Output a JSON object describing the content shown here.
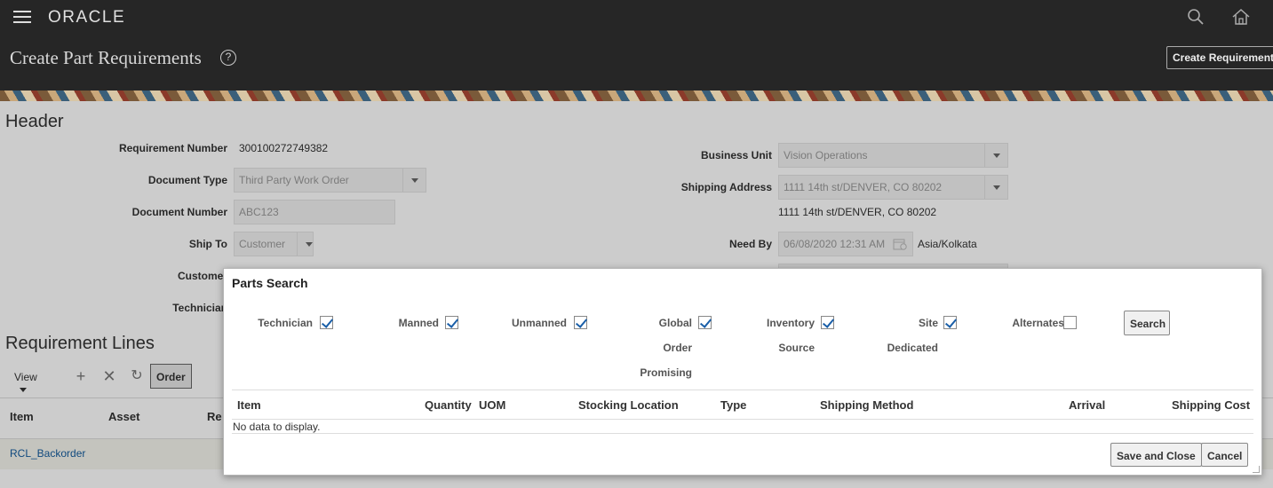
{
  "topbar": {
    "logo": "ORACLE",
    "page_title": "Create Part Requirements",
    "help": "?",
    "create_button": "Create Requirement"
  },
  "header": {
    "title": "Header",
    "requirement_number_label": "Requirement Number",
    "requirement_number": "300100272749382",
    "document_type_label": "Document Type",
    "document_type": "Third Party Work Order",
    "document_number_label": "Document Number",
    "document_number": "ABC123",
    "ship_to_label": "Ship To",
    "ship_to": "Customer",
    "customer_label": "Customer",
    "technician_label": "Technician",
    "business_unit_label": "Business Unit",
    "business_unit": "Vision Operations",
    "shipping_address_label": "Shipping Address",
    "shipping_address": "1111 14th st/DENVER, CO 80202",
    "shipping_address_text": "1111 14th st/DENVER, CO 80202",
    "need_by_label": "Need By",
    "need_by": "06/08/2020 12:31 AM",
    "timezone": "Asia/Kolkata"
  },
  "requirement_lines": {
    "title": "Requirement Lines",
    "view_label": "View",
    "order_button": "Order",
    "columns": [
      "Item",
      "Asset",
      "Re"
    ],
    "rows": [
      {
        "item": "RCL_Backorder"
      }
    ]
  },
  "dialog": {
    "title": "Parts Search",
    "options": [
      {
        "label": "Technician",
        "checked": true
      },
      {
        "label": "Manned",
        "checked": true
      },
      {
        "label": "Unmanned",
        "checked": true
      },
      {
        "label": "Global Order Promising",
        "lines": [
          "Global",
          "Order",
          "Promising"
        ],
        "checked": true
      },
      {
        "label": "Inventory Source",
        "lines": [
          "Inventory",
          "Source"
        ],
        "checked": true
      },
      {
        "label": "Site Dedicated",
        "lines": [
          "Site",
          "Dedicated"
        ],
        "checked": true
      },
      {
        "label": "Alternates",
        "checked": false
      }
    ],
    "search_button": "Search",
    "table_columns": [
      "Item",
      "Quantity",
      "UOM",
      "Stocking Location",
      "Type",
      "Shipping Method",
      "Arrival",
      "Shipping Cost"
    ],
    "no_data": "No data to display.",
    "save_close_button": "Save and Close",
    "cancel_button": "Cancel"
  }
}
